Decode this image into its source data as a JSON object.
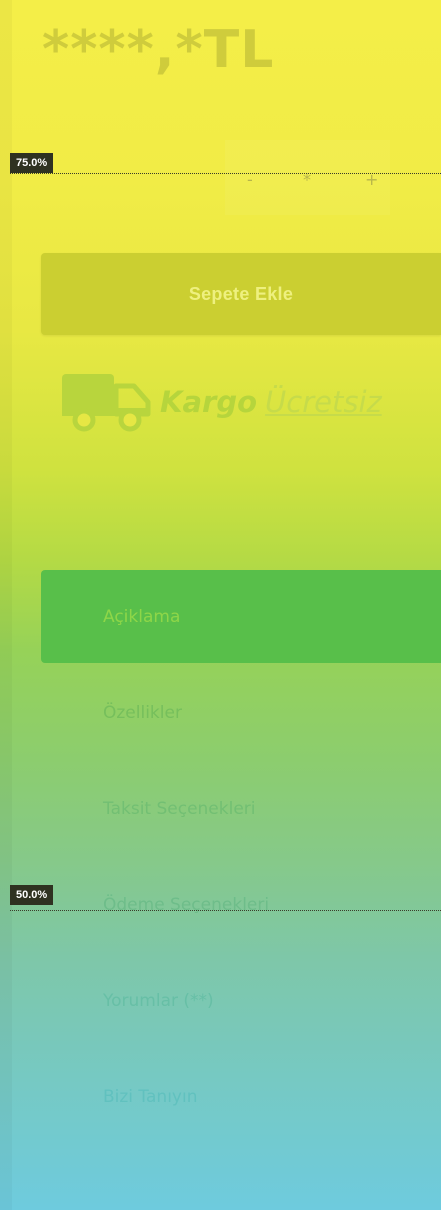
{
  "product": {
    "price": "****,*TL"
  },
  "stepper": {
    "minus": "-",
    "value": "*",
    "plus": "+"
  },
  "markers": [
    {
      "label": "75.0%"
    },
    {
      "label": "50.0%"
    }
  ],
  "cart": {
    "add_label": "Sepete Ekle"
  },
  "shipping": {
    "icon": "truck-icon",
    "kargo": "Kargo",
    "free": "Ücretsiz"
  },
  "tabs": [
    {
      "label": "Açiklama",
      "active": true
    },
    {
      "label": "Özellikler"
    },
    {
      "label": "Taksit Seçenekleri"
    },
    {
      "label": "Ödeme Seçenekleri"
    },
    {
      "label": "Yorumlar (**)"
    },
    {
      "label": "Bizi Tanıyın"
    }
  ],
  "colors": {
    "top": "#f4ee48",
    "bottom": "#6ecbde",
    "cart_button": "#cbcf31",
    "active_tab": "#58bf4a",
    "marker_bg": "#2f3221"
  }
}
